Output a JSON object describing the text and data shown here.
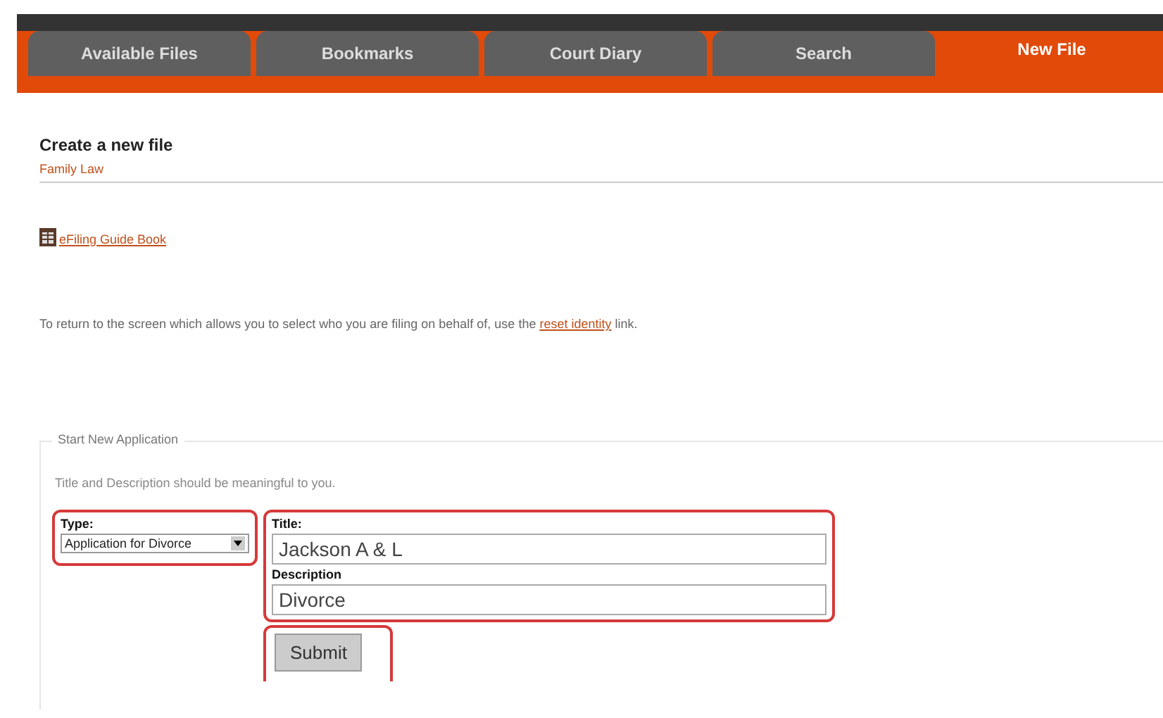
{
  "tabs": [
    {
      "label": "Available Files",
      "selected": false
    },
    {
      "label": "Bookmarks",
      "selected": false
    },
    {
      "label": "Court Diary",
      "selected": false
    },
    {
      "label": "Search",
      "selected": false
    },
    {
      "label": "New File",
      "selected": true
    }
  ],
  "heading": "Create a new file",
  "subheading": "Family Law",
  "guide_link": "eFiling Guide Book",
  "notice": {
    "before": "To return to the screen which allows you to select who you are filing on behalf of, use the",
    "link": "reset identity",
    "after": "link."
  },
  "form": {
    "legend": "Start New Application",
    "hint": "Title and Description should be meaningful to you.",
    "type": {
      "label": "Type:",
      "value": "Application for Divorce"
    },
    "title": {
      "label": "Title:",
      "value": "Jackson A & L"
    },
    "description": {
      "label": "Description",
      "value": "Divorce"
    },
    "submit": "Submit"
  }
}
